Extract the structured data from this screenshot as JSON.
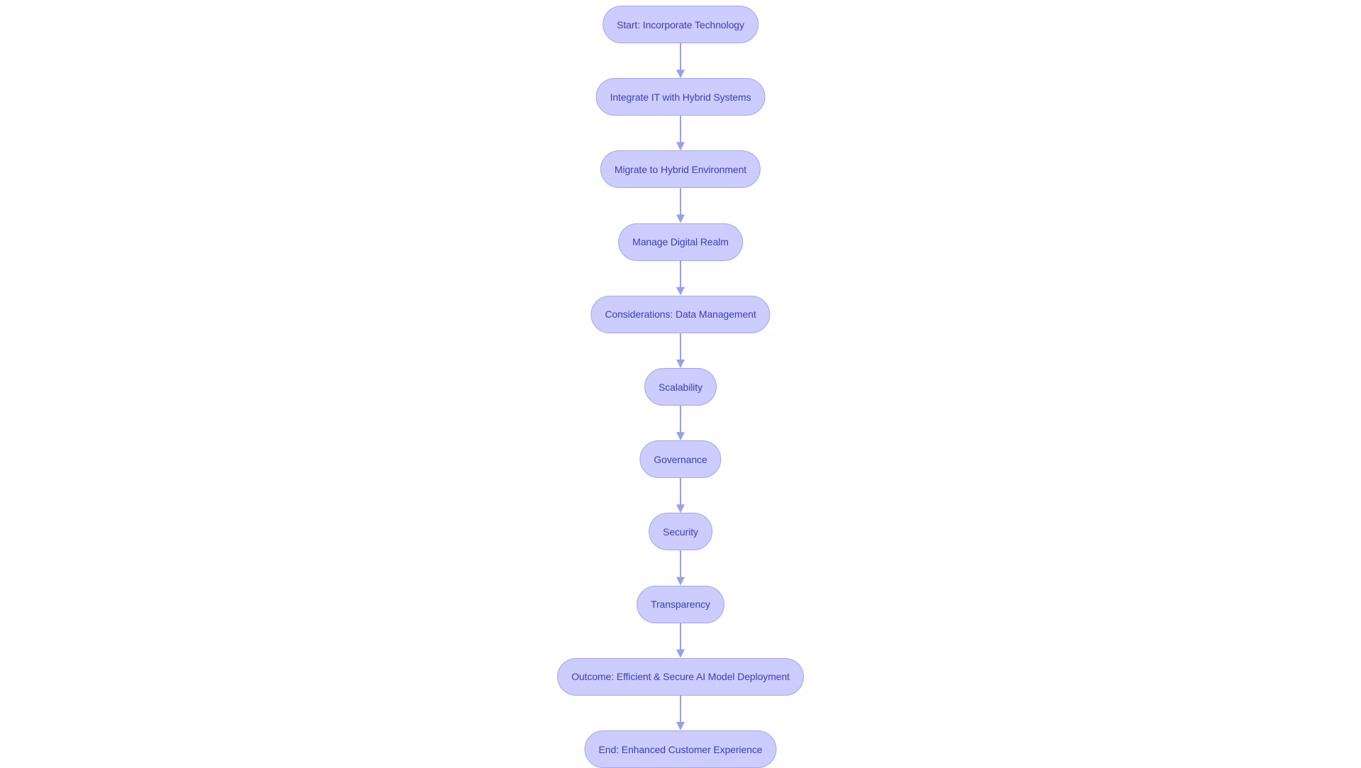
{
  "diagram": {
    "type": "flowchart",
    "direction": "top-to-bottom",
    "colors": {
      "node_fill": "#ccccff",
      "node_border": "#a3a6ec",
      "node_text": "#3d3fad",
      "edge": "#9aa0e6",
      "background": "#ffffff"
    },
    "nodes": [
      {
        "id": "n1",
        "label": "Start: Incorporate Technology"
      },
      {
        "id": "n2",
        "label": "Integrate IT with Hybrid Systems"
      },
      {
        "id": "n3",
        "label": "Migrate to Hybrid Environment"
      },
      {
        "id": "n4",
        "label": "Manage Digital Realm"
      },
      {
        "id": "n5",
        "label": "Considerations: Data Management"
      },
      {
        "id": "n6",
        "label": "Scalability"
      },
      {
        "id": "n7",
        "label": "Governance"
      },
      {
        "id": "n8",
        "label": "Security"
      },
      {
        "id": "n9",
        "label": "Transparency"
      },
      {
        "id": "n10",
        "label": "Outcome: Efficient & Secure AI Model Deployment"
      },
      {
        "id": "n11",
        "label": "End: Enhanced Customer Experience"
      }
    ],
    "edges": [
      {
        "from": "n1",
        "to": "n2"
      },
      {
        "from": "n2",
        "to": "n3"
      },
      {
        "from": "n3",
        "to": "n4"
      },
      {
        "from": "n4",
        "to": "n5"
      },
      {
        "from": "n5",
        "to": "n6"
      },
      {
        "from": "n6",
        "to": "n7"
      },
      {
        "from": "n7",
        "to": "n8"
      },
      {
        "from": "n8",
        "to": "n9"
      },
      {
        "from": "n9",
        "to": "n10"
      },
      {
        "from": "n10",
        "to": "n11"
      }
    ]
  }
}
